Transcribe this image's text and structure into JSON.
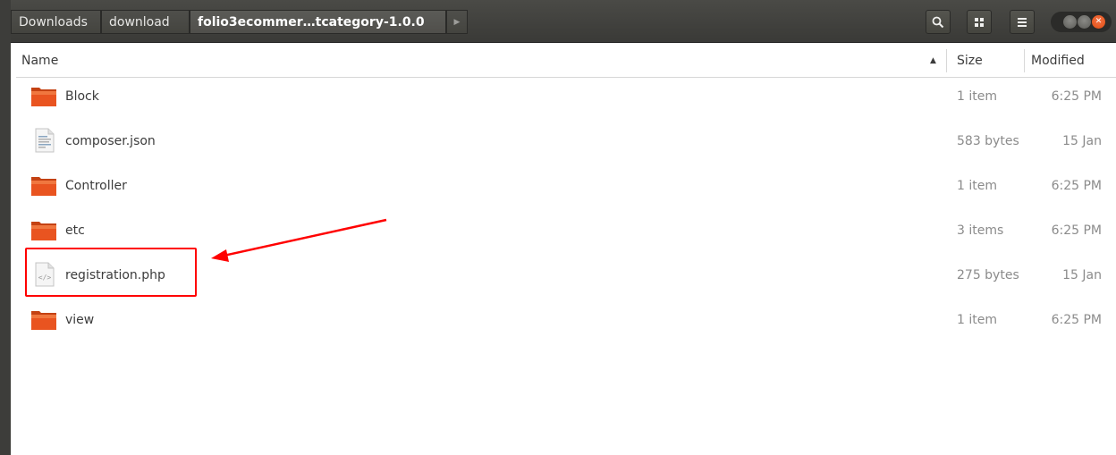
{
  "window": {
    "breadcrumbs": [
      {
        "label": "Downloads"
      },
      {
        "label": "download"
      },
      {
        "label": "folio3ecommer…tcategory-1.0.0"
      }
    ]
  },
  "columns": {
    "name": "Name",
    "size": "Size",
    "modified": "Modified",
    "sort": "ascending"
  },
  "files": [
    {
      "name": "Block",
      "type": "folder",
      "size": "1 item",
      "modified": "6:25 PM"
    },
    {
      "name": "composer.json",
      "type": "text-file",
      "size": "583 bytes",
      "modified": "15 Jan"
    },
    {
      "name": "Controller",
      "type": "folder",
      "size": "1 item",
      "modified": "6:25 PM"
    },
    {
      "name": "etc",
      "type": "folder",
      "size": "3 items",
      "modified": "6:25 PM"
    },
    {
      "name": "registration.php",
      "type": "code-file",
      "size": "275 bytes",
      "modified": "15 Jan"
    },
    {
      "name": "view",
      "type": "folder",
      "size": "1 item",
      "modified": "6:25 PM"
    }
  ],
  "annotation": {
    "highlighted_file": "registration.php",
    "color": "#ff0000"
  },
  "icons": {
    "search": "search-icon",
    "view_toggle": "grid-view-icon",
    "menu": "hamburger-menu-icon"
  },
  "colors": {
    "headerbar": "#3d3d3a",
    "folder": "#e95420",
    "close_button": "#e95420"
  }
}
